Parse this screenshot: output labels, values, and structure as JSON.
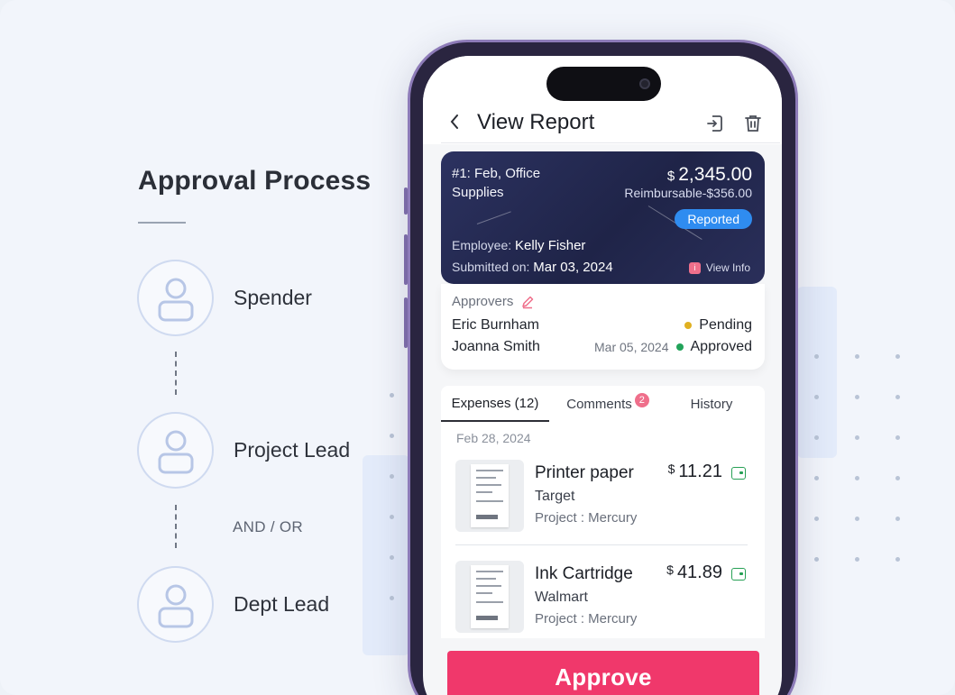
{
  "process": {
    "title": "Approval Process",
    "steps": [
      {
        "label": "Spender"
      },
      {
        "label": "Project Lead"
      },
      {
        "label": "Dept Lead"
      }
    ],
    "connector_text": "AND / OR"
  },
  "app": {
    "title": "View Report",
    "icons": {
      "back": "back-chevron-icon",
      "submit": "submit-report-icon",
      "delete": "trash-icon"
    }
  },
  "report": {
    "name": "#1: Feb, Office Supplies",
    "currency_symbol": "$",
    "amount": "2,345.00",
    "reimbursable": "Reimbursable-$356.00",
    "status": "Reported",
    "employee_label": "Employee:",
    "employee": "Kelly Fisher",
    "submitted_label": "Submitted on:",
    "submitted": "Mar 03, 2024",
    "view_info": "View Info"
  },
  "approvers": {
    "heading": "Approvers",
    "items": [
      {
        "name": "Eric Burnham",
        "date": "",
        "status": "Pending",
        "color": "#e0b021"
      },
      {
        "name": "Joanna Smith",
        "date": "Mar 05, 2024",
        "status": "Approved",
        "color": "#22a35a"
      }
    ]
  },
  "tabs": [
    {
      "label": "Expenses (12)",
      "badge": ""
    },
    {
      "label": "Comments",
      "badge": "2"
    },
    {
      "label": "History",
      "badge": ""
    }
  ],
  "expenses": {
    "date": "Feb 28, 2024",
    "items": [
      {
        "title": "Printer paper",
        "vendor": "Target",
        "project": "Project : Mercury",
        "currency_symbol": "$",
        "amount": "11.21"
      },
      {
        "title": "Ink Cartridge",
        "vendor": "Walmart",
        "project": "Project : Mercury",
        "currency_symbol": "$",
        "amount": "41.89"
      }
    ]
  },
  "actions": {
    "approve": "Approve"
  },
  "colors": {
    "accent": "#f0386b",
    "badge_blue": "#2f8cf0",
    "card_bg": "#222850"
  }
}
